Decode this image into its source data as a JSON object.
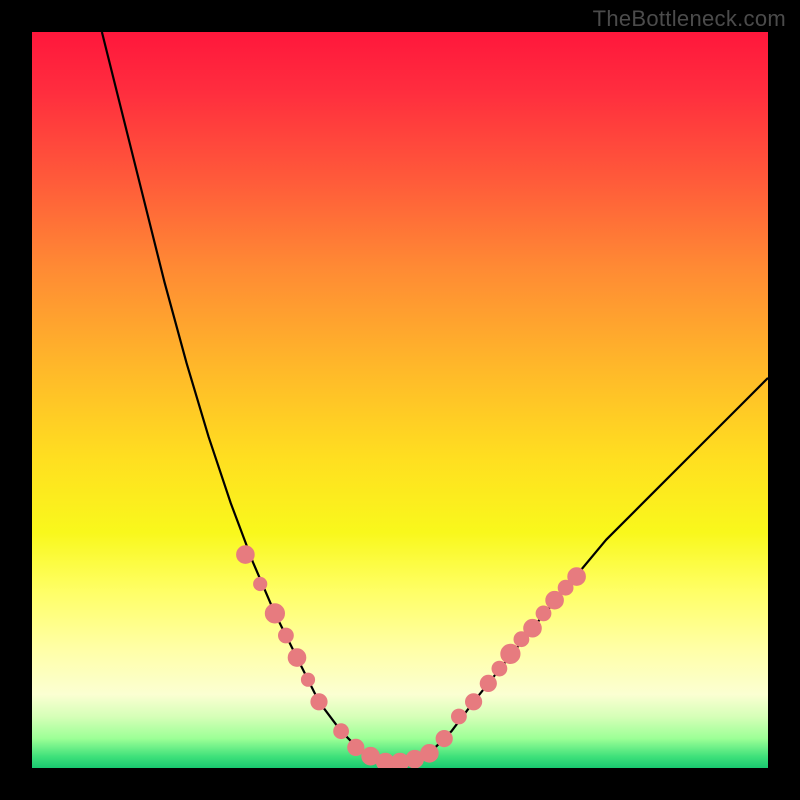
{
  "watermark": "TheBottleneck.com",
  "chart_data": {
    "type": "line",
    "title": "",
    "xlabel": "",
    "ylabel": "",
    "xlim": [
      0,
      100
    ],
    "ylim": [
      0,
      100
    ],
    "background": "rainbow-gradient (red top → green bottom)",
    "curve_description": "Asymmetric V / bathtub curve: steep descent from top-left, flat minimum near x≈45–55, moderate rise toward upper-right edge",
    "curve_points": [
      {
        "x": 9.5,
        "y": 100
      },
      {
        "x": 12,
        "y": 90
      },
      {
        "x": 15,
        "y": 78
      },
      {
        "x": 18,
        "y": 66
      },
      {
        "x": 21,
        "y": 55
      },
      {
        "x": 24,
        "y": 45
      },
      {
        "x": 27,
        "y": 36
      },
      {
        "x": 30,
        "y": 28
      },
      {
        "x": 33,
        "y": 21
      },
      {
        "x": 36,
        "y": 15
      },
      {
        "x": 39,
        "y": 9
      },
      {
        "x": 42,
        "y": 5
      },
      {
        "x": 45,
        "y": 2
      },
      {
        "x": 48,
        "y": 0.7
      },
      {
        "x": 51,
        "y": 0.7
      },
      {
        "x": 54,
        "y": 2
      },
      {
        "x": 57,
        "y": 5
      },
      {
        "x": 60,
        "y": 9
      },
      {
        "x": 64,
        "y": 14
      },
      {
        "x": 68,
        "y": 19
      },
      {
        "x": 73,
        "y": 25
      },
      {
        "x": 78,
        "y": 31
      },
      {
        "x": 84,
        "y": 37
      },
      {
        "x": 90,
        "y": 43
      },
      {
        "x": 96,
        "y": 49
      },
      {
        "x": 100,
        "y": 53
      }
    ],
    "markers": [
      {
        "x": 29,
        "y": 29,
        "r": 1.2
      },
      {
        "x": 31,
        "y": 25,
        "r": 0.9
      },
      {
        "x": 33,
        "y": 21,
        "r": 1.3
      },
      {
        "x": 34.5,
        "y": 18,
        "r": 1.0
      },
      {
        "x": 36,
        "y": 15,
        "r": 1.2
      },
      {
        "x": 37.5,
        "y": 12,
        "r": 0.9
      },
      {
        "x": 39,
        "y": 9,
        "r": 1.1
      },
      {
        "x": 42,
        "y": 5,
        "r": 1.0
      },
      {
        "x": 44,
        "y": 2.8,
        "r": 1.1
      },
      {
        "x": 46,
        "y": 1.6,
        "r": 1.2
      },
      {
        "x": 48,
        "y": 0.8,
        "r": 1.2
      },
      {
        "x": 50,
        "y": 0.8,
        "r": 1.2
      },
      {
        "x": 52,
        "y": 1.2,
        "r": 1.2
      },
      {
        "x": 54,
        "y": 2,
        "r": 1.2
      },
      {
        "x": 56,
        "y": 4,
        "r": 1.1
      },
      {
        "x": 58,
        "y": 7,
        "r": 1.0
      },
      {
        "x": 60,
        "y": 9,
        "r": 1.1
      },
      {
        "x": 62,
        "y": 11.5,
        "r": 1.1
      },
      {
        "x": 63.5,
        "y": 13.5,
        "r": 1.0
      },
      {
        "x": 65,
        "y": 15.5,
        "r": 1.3
      },
      {
        "x": 66.5,
        "y": 17.5,
        "r": 1.0
      },
      {
        "x": 68,
        "y": 19,
        "r": 1.2
      },
      {
        "x": 69.5,
        "y": 21,
        "r": 1.0
      },
      {
        "x": 71,
        "y": 22.8,
        "r": 1.2
      },
      {
        "x": 72.5,
        "y": 24.5,
        "r": 1.0
      },
      {
        "x": 74,
        "y": 26,
        "r": 1.2
      }
    ]
  }
}
